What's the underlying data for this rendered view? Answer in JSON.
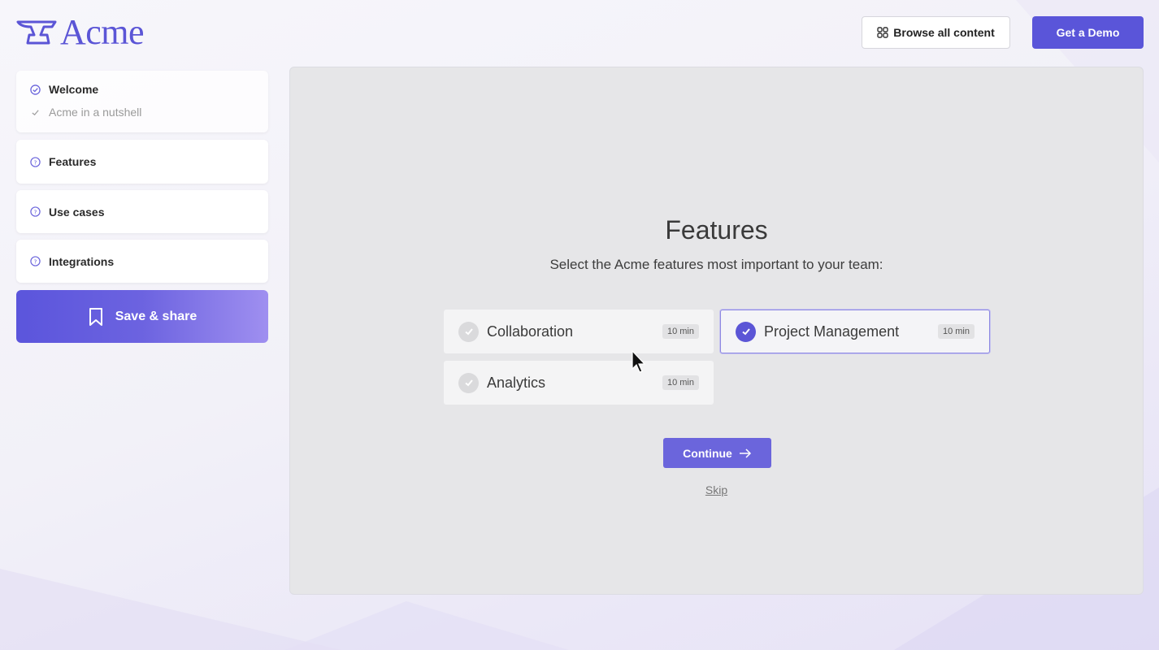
{
  "brand": {
    "name": "Acme",
    "accent": "#5a55d9"
  },
  "header": {
    "browse_label": "Browse all content",
    "browse_icon": "grid-icon",
    "demo_label": "Get a Demo"
  },
  "sidebar": {
    "welcome": {
      "label": "Welcome",
      "icon": "check-circle-icon",
      "sub_label": "Acme in a nutshell",
      "sub_icon": "check-icon"
    },
    "items": [
      {
        "label": "Features",
        "icon": "question-bubble-icon"
      },
      {
        "label": "Use cases",
        "icon": "question-bubble-icon"
      },
      {
        "label": "Integrations",
        "icon": "question-bubble-icon"
      }
    ],
    "save_label": "Save & share",
    "save_icon": "bookmark-icon"
  },
  "main": {
    "title": "Features",
    "subtitle": "Select the Acme features most important to your team:",
    "options": [
      {
        "name": "Collaboration",
        "duration": "10 min",
        "selected": false
      },
      {
        "name": "Project Management",
        "duration": "10 min",
        "selected": true
      },
      {
        "name": "Analytics",
        "duration": "10 min",
        "selected": false
      }
    ],
    "continue_label": "Continue",
    "skip_label": "Skip"
  }
}
